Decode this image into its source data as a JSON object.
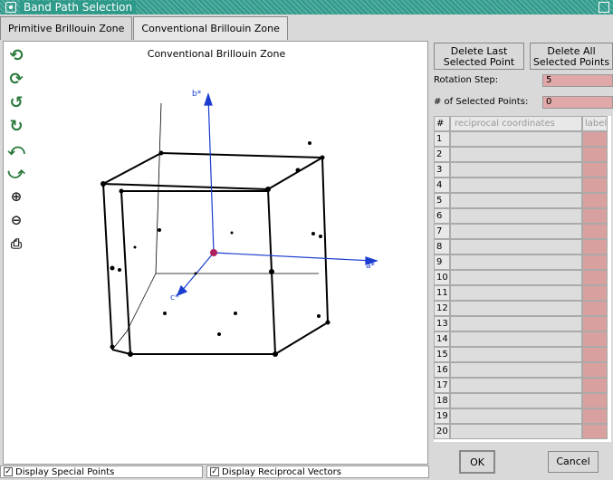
{
  "window": {
    "title": "Band Path Selection"
  },
  "tabs": [
    {
      "label": "Primitive Brillouin Zone"
    },
    {
      "label": "Conventional Brillouin Zone"
    }
  ],
  "canvas": {
    "title": "Conventional Brillouin Zone",
    "axes": {
      "b": "b*",
      "a": "a*",
      "c": "c*"
    }
  },
  "toolbar": {
    "icons": [
      "rotate-up-icon",
      "rotate-down-icon",
      "rotate-left-icon",
      "rotate-right-icon",
      "rotate-ccw-icon",
      "rotate-cw-icon",
      "zoom-in-icon",
      "zoom-out-icon",
      "print-icon"
    ]
  },
  "right": {
    "delete_last": "Delete Last Selected Point",
    "delete_all": "Delete All Selected Points",
    "rotation_step_label": "Rotation Step:",
    "rotation_step_value": "5",
    "num_selected_label": "# of Selected Points:",
    "num_selected_value": "0",
    "table_headers": {
      "num": "#",
      "coords": "reciprocal coordinates",
      "label": "label"
    },
    "table_rows": [
      "1",
      "2",
      "3",
      "4",
      "5",
      "6",
      "7",
      "8",
      "9",
      "10",
      "11",
      "12",
      "13",
      "14",
      "15",
      "16",
      "17",
      "18",
      "19",
      "20"
    ],
    "ok": "OK",
    "cancel": "Cancel"
  },
  "bottom": {
    "display_special_points": "Display Special Points",
    "display_reciprocal_vectors": "Display Reciprocal Vectors",
    "special_points_checked": true,
    "reciprocal_vectors_checked": true
  },
  "colors": {
    "titlebar": "#2e9a8a",
    "field": "#e0a8a8",
    "axis": "#1a3ccf",
    "origin": "#b0205a"
  }
}
